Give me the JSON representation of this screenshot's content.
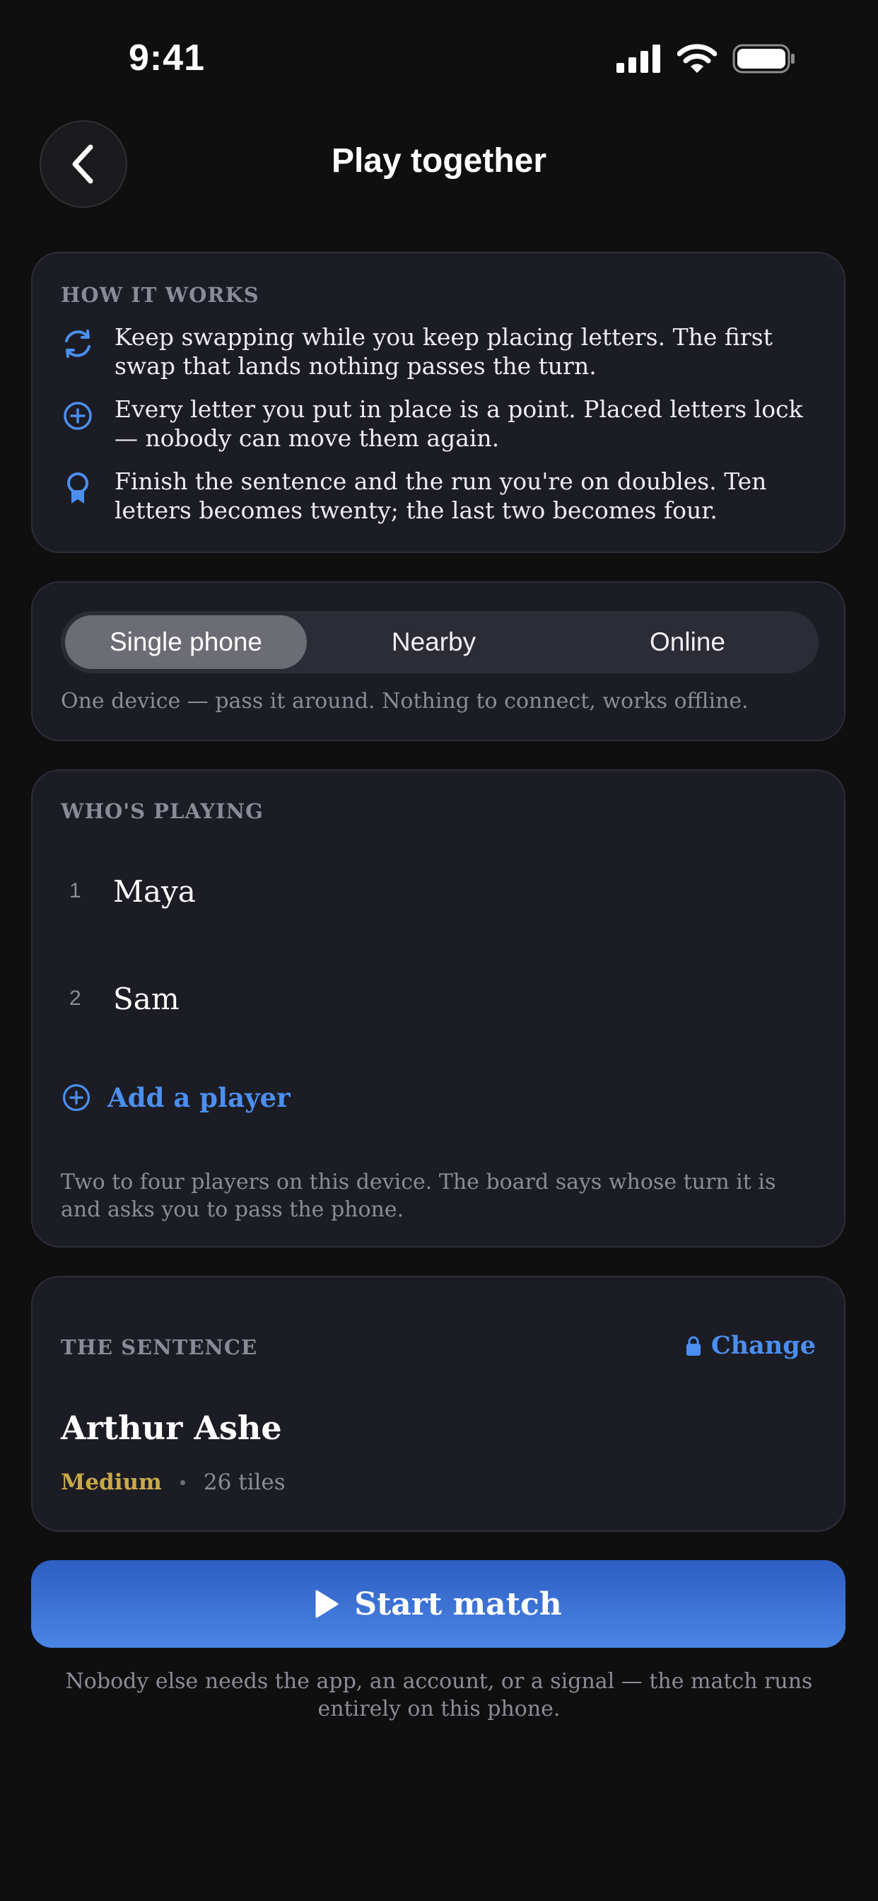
{
  "status_bar": {
    "time": "9:41"
  },
  "header": {
    "title": "Play together"
  },
  "how_it_works": {
    "label": "HOW IT WORKS",
    "items": [
      {
        "icon": "swap-cycle-icon",
        "text": "Keep swapping while you keep placing letters. The first swap that lands nothing passes the turn."
      },
      {
        "icon": "plus-circle-icon",
        "text": "Every letter you put in place is a point. Placed letters lock — nobody can move them again."
      },
      {
        "icon": "award-ribbon-icon",
        "text": "Finish the sentence and the run you're on doubles. Ten letters becomes twenty; the last two becomes four."
      }
    ]
  },
  "mode": {
    "options": [
      "Single phone",
      "Nearby",
      "Online"
    ],
    "selected": "Single phone",
    "description": "One device — pass it around. Nothing to connect, works offline."
  },
  "players": {
    "label": "WHO'S PLAYING",
    "list": [
      {
        "number": "1",
        "name": "Maya"
      },
      {
        "number": "2",
        "name": "Sam"
      }
    ],
    "add_label": "Add a player",
    "description": "Two to four players on this device. The board says whose turn it is and asks you to pass the phone."
  },
  "sentence": {
    "label": "THE SENTENCE",
    "change_label": "Change",
    "title": "Arthur Ashe",
    "difficulty": "Medium",
    "tiles": "26 tiles"
  },
  "start": {
    "label": "Start match"
  },
  "footer_note": "Nobody else needs the app, an account, or a signal — the match runs entirely on this phone.",
  "colors": {
    "accent": "#4b8ff0",
    "difficulty": "#c9a948",
    "card": "#1c1c25",
    "background": "#0f0f10"
  }
}
